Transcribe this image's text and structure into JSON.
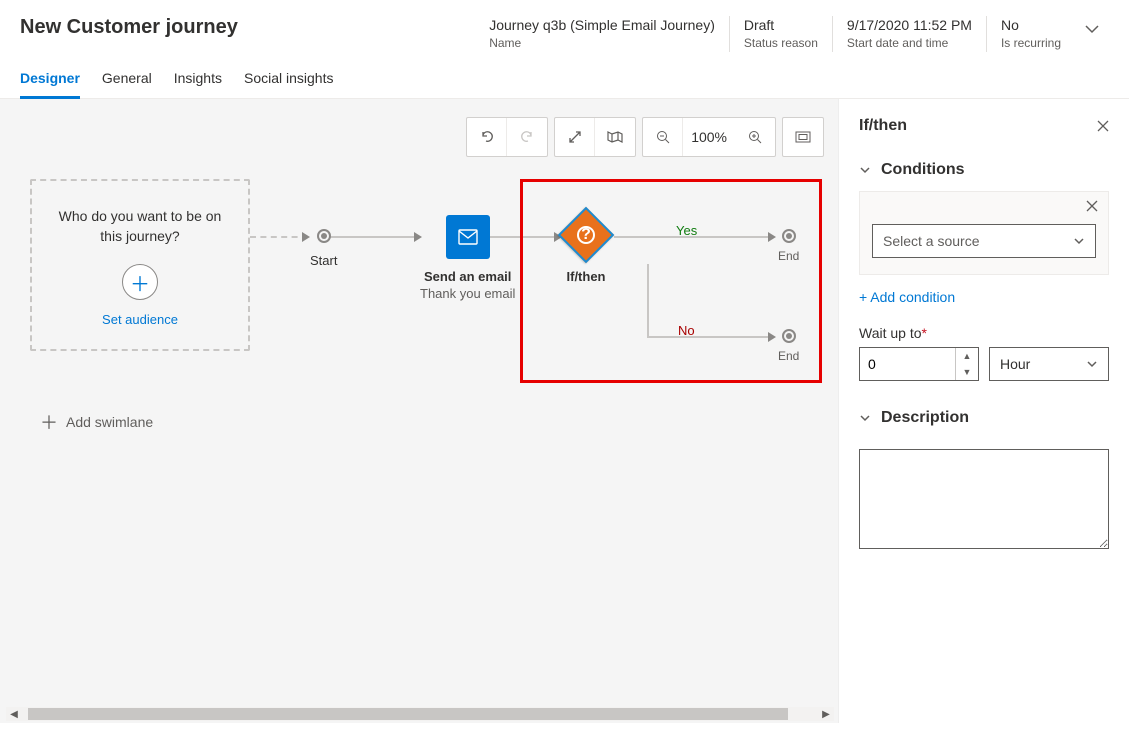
{
  "header": {
    "title": "New Customer journey",
    "meta": [
      {
        "value": "Journey q3b (Simple Email Journey)",
        "label": "Name"
      },
      {
        "value": "Draft",
        "label": "Status reason"
      },
      {
        "value": "9/17/2020 11:52 PM",
        "label": "Start date and time"
      },
      {
        "value": "No",
        "label": "Is recurring"
      }
    ]
  },
  "tabs": [
    "Designer",
    "General",
    "Insights",
    "Social insights"
  ],
  "toolbar": {
    "zoom": "100%"
  },
  "canvas": {
    "audience_question": "Who do you want to be on this journey?",
    "set_audience": "Set audience",
    "add_swimlane": "Add swimlane",
    "start_label": "Start",
    "email_title": "Send an email",
    "email_subtitle": "Thank you email",
    "ifthen_label": "If/then",
    "yes_label": "Yes",
    "no_label": "No",
    "end_label": "End"
  },
  "panel": {
    "title": "If/then",
    "conditions_heading": "Conditions",
    "source_placeholder": "Select a source",
    "add_condition": "+ Add condition",
    "wait_label": "Wait up to",
    "wait_value": "0",
    "wait_unit": "Hour",
    "description_heading": "Description"
  }
}
